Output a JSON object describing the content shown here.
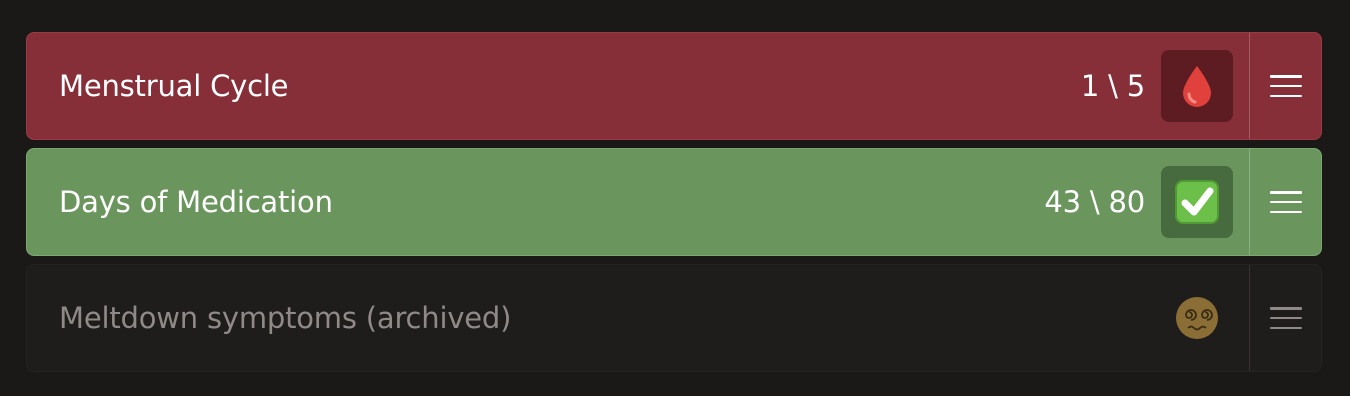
{
  "trackers": [
    {
      "title": "Menstrual Cycle",
      "count": "1 \\ 5",
      "icon": "drop-of-blood-icon",
      "color": "#872f38"
    },
    {
      "title": "Days of Medication",
      "count": "43 \\ 80",
      "icon": "check-mark-button-icon",
      "color": "#6a965e"
    },
    {
      "title": "Meltdown symptoms (archived)",
      "count": "",
      "icon": "dizzy-face-icon",
      "color": "#1f1c1c",
      "archived": true
    }
  ]
}
